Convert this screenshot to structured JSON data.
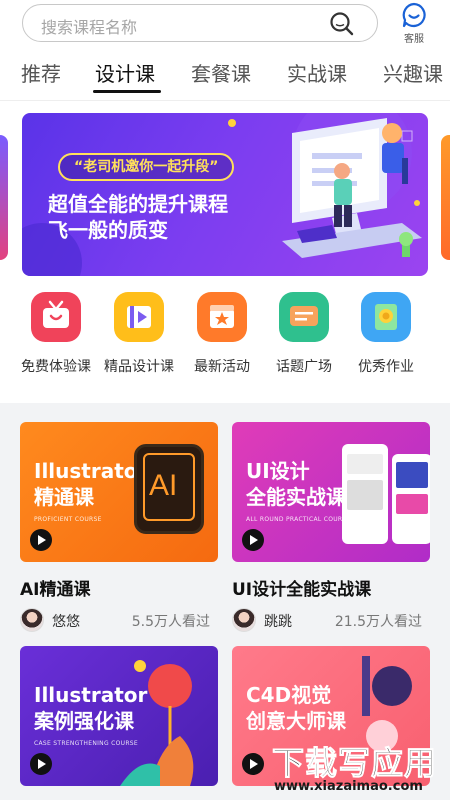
{
  "search": {
    "placeholder": "搜索课程名称"
  },
  "service": {
    "label": "客服"
  },
  "tabs": [
    {
      "label": "推荐"
    },
    {
      "label": "设计课"
    },
    {
      "label": "套餐课"
    },
    {
      "label": "实战课"
    },
    {
      "label": "兴趣课"
    }
  ],
  "active_tab_index": 1,
  "banner": {
    "pill": "“老司机邀你一起升段”",
    "line1": "超值全能的提升课程",
    "line2": "飞一般的质变"
  },
  "categories": [
    {
      "label": "免费体验课",
      "icon": "tv-icon",
      "color": "#f0435a"
    },
    {
      "label": "精品设计课",
      "icon": "video-icon",
      "color": "#ffbe1a"
    },
    {
      "label": "最新活动",
      "icon": "star-box-icon",
      "color": "#ff7a2a"
    },
    {
      "label": "话题广场",
      "icon": "chat-icon",
      "color": "#2fc08e"
    },
    {
      "label": "优秀作业",
      "icon": "medal-icon",
      "color": "#3fa6f4"
    }
  ],
  "courses": [
    {
      "image_title_1": "Illustrator",
      "image_title_2": "精通课",
      "image_sub": "PROFICIENT COURSE",
      "badge": "AI",
      "name": "AI精通课",
      "author": "悠悠",
      "views": "5.5万人看过"
    },
    {
      "image_title_1": "UI设计",
      "image_title_2": "全能实战课",
      "image_sub": "ALL ROUND PRACTICAL COURSE",
      "name": "UI设计全能实战课",
      "author": "跳跳",
      "views": "21.5万人看过"
    },
    {
      "image_title_1": "Illustrator",
      "image_title_2": "案例强化课",
      "image_sub": "CASE STRENGTHENING COURSE"
    },
    {
      "image_title_1": "C4D视觉",
      "image_title_2": "创意大师课"
    }
  ],
  "watermark": {
    "big": "下载写应用",
    "small": "www.xiazaimao.com"
  }
}
